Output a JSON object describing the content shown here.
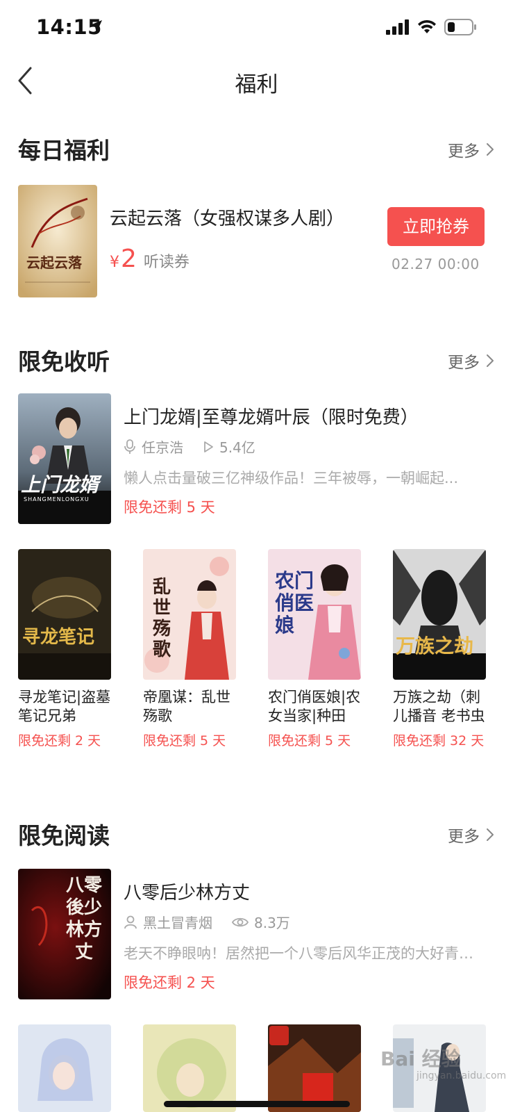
{
  "status": {
    "time": "14:15"
  },
  "nav": {
    "title": "福利"
  },
  "daily": {
    "section_title": "每日福利",
    "more": "更多",
    "item": {
      "title": "云起云落（女强权谋多人剧）",
      "cover_text": "云起云落",
      "currency": "¥",
      "amount": "2",
      "unit": "听读券",
      "button": "立即抢券",
      "time": "02.27 00:00"
    }
  },
  "free_listen": {
    "section_title": "限免收听",
    "more": "更多",
    "featured": {
      "title": "上门龙婿|至尊龙婿叶辰（限时免费）",
      "cover_text": "上门龙婿",
      "cover_sub": "SHANGMENLONGXU",
      "author": "任京浩",
      "plays": "5.4亿",
      "desc": "懒人点击量破三亿神级作品！三年被辱，一朝崛起...",
      "free": "限免还剩 5 天"
    },
    "grid": [
      {
        "title": "寻龙笔记|盗墓笔记兄弟",
        "cover_text": "寻龙笔记",
        "free": "限免还剩 2 天"
      },
      {
        "title": "帝凰谋：乱世殇歌",
        "cover_text": "乱世殇歌",
        "free": "限免还剩 5 天"
      },
      {
        "title": "农门俏医娘|农女当家|种田",
        "cover_text": "农门俏医娘",
        "free": "限免还剩 5 天"
      },
      {
        "title": "万族之劫（刺儿播音 老书虫",
        "cover_text": "万族之劫",
        "free": "限免还剩 32 天"
      }
    ]
  },
  "free_read": {
    "section_title": "限免阅读",
    "more": "更多",
    "featured": {
      "title": "八零后少林方丈",
      "cover_text": "八零後少林方丈",
      "author": "黑土冒青烟",
      "views": "8.3万",
      "desc": "老天不睁眼呐！居然把一个八零后风华正茂的大好青年...",
      "free": "限免还剩 2 天"
    }
  },
  "watermark": {
    "text": "Bai 经验",
    "sub": "jingyan.baidu.com"
  },
  "colors": {
    "accent": "#f5514f",
    "text": "#222222",
    "muted": "#999999"
  }
}
